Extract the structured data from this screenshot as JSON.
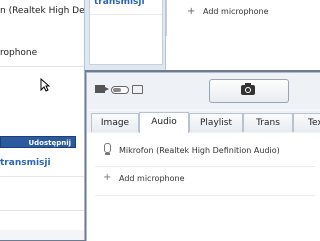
{
  "back_window": {
    "mic_label": "n (Realtek High Definition",
    "mic_sub": "rophone",
    "share_button": "Udostępnij",
    "transmit_label": "transmisji"
  },
  "middle_window": {
    "transmit_label": "transmisji"
  },
  "top_right_panel": {
    "add_microphone": "Add microphone"
  },
  "main_window": {
    "tabs": [
      {
        "label": "Image",
        "active": false
      },
      {
        "label": "Audio",
        "active": true
      },
      {
        "label": "Playlist",
        "active": false
      },
      {
        "label": "Trans",
        "active": false
      },
      {
        "label": "Tex",
        "active": false
      }
    ],
    "audio": {
      "mic_device": "Mikrofon (Realtek High Definition Audio)",
      "add_microphone": "Add microphone"
    }
  },
  "icons": {
    "video": "video-camera-icon",
    "toggle": "toggle-switch-icon",
    "camera": "camera-icon",
    "snapshot": "snapshot-camera-icon",
    "microphone": "microphone-icon",
    "plus": "plus-icon",
    "cursor": "mouse-cursor-icon"
  },
  "colors": {
    "accent_blue": "#2a64b4",
    "share_button_bg": "#2c5aa0",
    "desktop_bg": "#6d7c90"
  }
}
